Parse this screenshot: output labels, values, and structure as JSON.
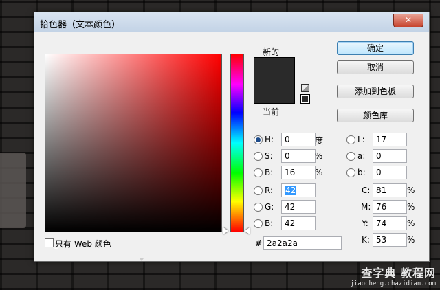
{
  "background": {
    "watermark_line1": "查字典 教程网",
    "watermark_line2": "jiaocheng.chazidian.com"
  },
  "dialog": {
    "title": "拾色器（文本颜色）",
    "close_glyph": "✕",
    "new_label": "新的",
    "current_label": "当前",
    "new_color": "#2a2a2a",
    "current_color": "#2a2a2a"
  },
  "buttons": {
    "ok": "确定",
    "cancel": "取消",
    "add_to_swatches": "添加到色板",
    "color_library": "颜色库"
  },
  "hsb": {
    "h_label": "H:",
    "h_value": "0",
    "h_unit": "度",
    "s_label": "S:",
    "s_value": "0",
    "s_unit": "%",
    "b_label": "B:",
    "b_value": "16",
    "b_unit": "%"
  },
  "rgb": {
    "r_label": "R:",
    "r_value": "42",
    "g_label": "G:",
    "g_value": "42",
    "b_label": "B:",
    "b_value": "42"
  },
  "lab": {
    "l_label": "L:",
    "l_value": "17",
    "a_label": "a:",
    "a_value": "0",
    "b_label": "b:",
    "b_value": "0"
  },
  "cmyk": {
    "c_label": "C:",
    "c_value": "81",
    "c_unit": "%",
    "m_label": "M:",
    "m_value": "76",
    "m_unit": "%",
    "y_label": "Y:",
    "y_value": "74",
    "y_unit": "%",
    "k_label": "K:",
    "k_value": "53",
    "k_unit": "%"
  },
  "hex": {
    "label": "#",
    "value": "2a2a2a"
  },
  "web_only": {
    "label": "只有 Web 颜色",
    "checked": false
  },
  "icons": [
    "close-icon",
    "cube-icon",
    "web-safe-swatch-icon",
    "color-field-picker-icon",
    "hue-slider-arrow-icon"
  ]
}
